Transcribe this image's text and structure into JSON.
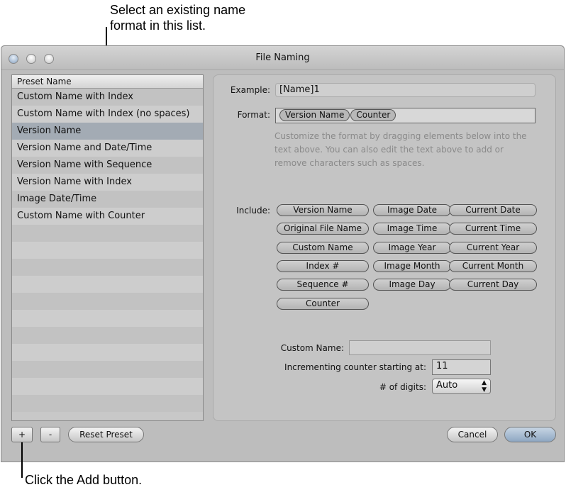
{
  "callouts": {
    "top_line1": "Select an existing name",
    "top_line2": "format in this list.",
    "bottom": "Click the Add button."
  },
  "window": {
    "title": "File Naming"
  },
  "list": {
    "header": "Preset Name",
    "items": [
      "Custom Name with Index",
      "Custom Name with Index (no spaces)",
      "Version Name",
      "Version Name and Date/Time",
      "Version Name with Sequence",
      "Version Name with Index",
      "Image Date/Time",
      "Custom Name with Counter"
    ],
    "selected": "Version Name"
  },
  "panel": {
    "example_label": "Example:",
    "example_value": "[Name]1",
    "format_label": "Format:",
    "format_tokens": [
      "Version Name",
      "Counter"
    ],
    "help": "Customize the format by dragging elements below into the text above. You can also edit the text above to add or remove characters such as spaces.",
    "include_label": "Include:",
    "include": [
      [
        "Version Name",
        "Image Date",
        "Current Date"
      ],
      [
        "Original File Name",
        "Image Time",
        "Current Time"
      ],
      [
        "Custom Name",
        "Image Year",
        "Current Year"
      ],
      [
        "Index #",
        "Image Month",
        "Current Month"
      ],
      [
        "Sequence #",
        "Image Day",
        "Current Day"
      ],
      [
        "Counter"
      ]
    ],
    "custom_name_label": "Custom Name:",
    "custom_name_value": "",
    "counter_label": "Incrementing counter starting at:",
    "counter_value": "11",
    "digits_label": "# of digits:",
    "digits_value": "Auto"
  },
  "buttons": {
    "add": "+",
    "remove": "-",
    "reset": "Reset Preset",
    "cancel": "Cancel",
    "ok": "OK"
  }
}
